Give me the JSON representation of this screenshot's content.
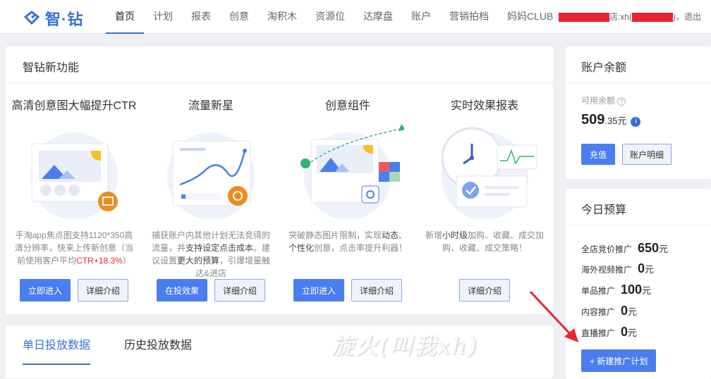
{
  "logo": {
    "text": "智·钻"
  },
  "nav": [
    "首页",
    "计划",
    "报表",
    "创意",
    "淘积木",
    "资源位",
    "达摩盘",
    "账户",
    "营销拍档",
    "妈妈CLUB"
  ],
  "user": {
    "visible_text": "店:xh(",
    "suffix": ")",
    "logout": "，退出"
  },
  "features": {
    "title": "智钻新功能",
    "items": [
      {
        "title": "高清创意图大幅提升CTR",
        "desc": [
          "手淘app焦点图支持1120*350高清分辨率，快来上传新创意（当前使用客户平均",
          "CTR+18.3%",
          "）"
        ],
        "buttons": [
          "立即进入",
          "详细介绍"
        ]
      },
      {
        "title": "流量新星",
        "desc": [
          "捕获账户内其他计划无法竞得的流量，并",
          "支持设定点击成本",
          "。建议设置",
          "更大的预算",
          "，引爆增量触达&进店"
        ],
        "buttons": [
          "在投效果",
          "详细介绍"
        ]
      },
      {
        "title": "创意组件",
        "desc": [
          "突破静态图片限制，实现",
          "动态",
          "、",
          "个性化",
          "创意，点击率提升利器！"
        ],
        "buttons": [
          "立即进入",
          "详细介绍"
        ]
      },
      {
        "title": "实时效果报表",
        "desc": [
          "新增",
          "小时级",
          "加购、收藏、成交加购、收藏、成交策略！"
        ],
        "buttons": [
          "详细介绍"
        ]
      }
    ]
  },
  "tabs": [
    "单日投放数据",
    "历史投放数据"
  ],
  "watermark": "旋火(叫我xh)",
  "balance": {
    "title": "账户余额",
    "available_label": "可用余额",
    "help": "?",
    "amount_int": "509",
    "amount_dec": ".35",
    "unit": "元",
    "info": "i",
    "recharge": "充值",
    "details": "账户明细"
  },
  "budget": {
    "title": "今日预算",
    "rows": [
      {
        "label": "全店竞价推广",
        "value": "650",
        "unit": "元"
      },
      {
        "label": "海外视频推广",
        "value": "0",
        "unit": "元"
      },
      {
        "label": "单品推广",
        "value": "100",
        "unit": "元"
      },
      {
        "label": "内容推广",
        "value": "0",
        "unit": "元"
      },
      {
        "label": "直播推广",
        "value": "0",
        "unit": "元"
      }
    ],
    "new_plan": "+ 新建推广计划"
  }
}
